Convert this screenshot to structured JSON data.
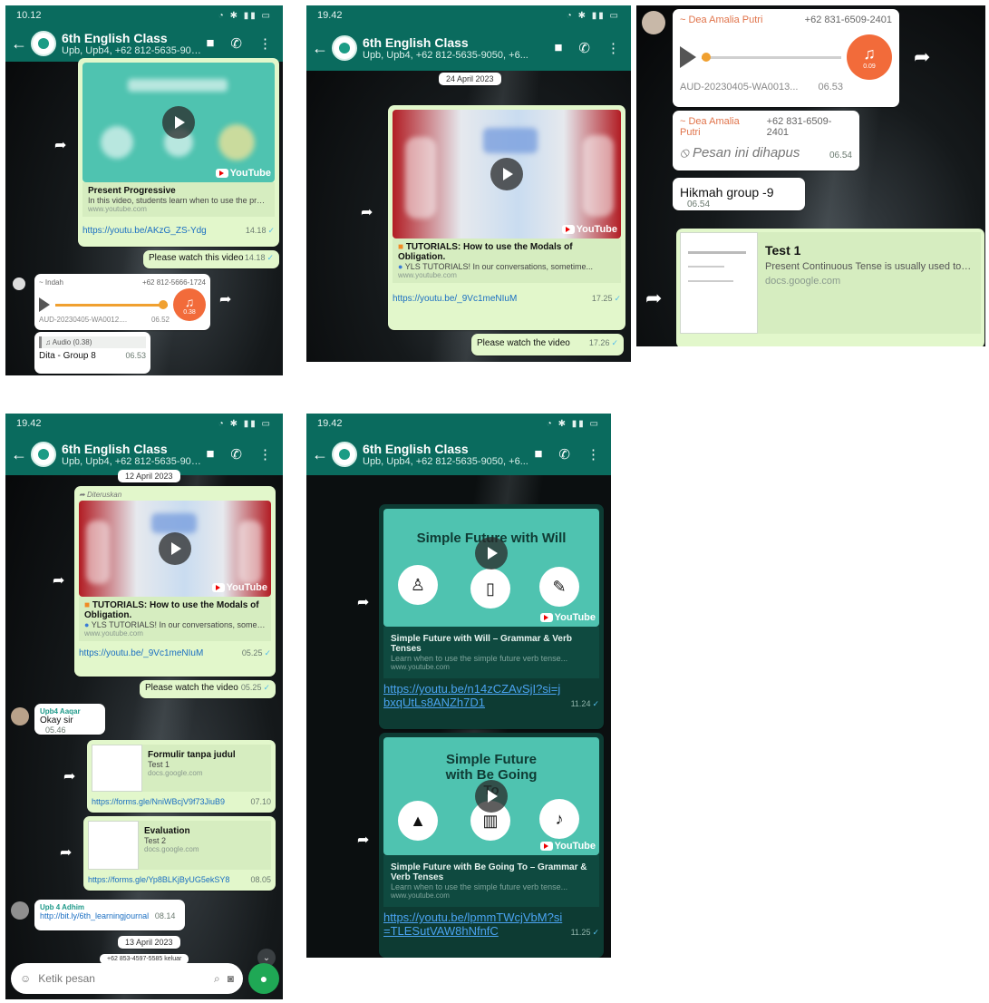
{
  "header": {
    "time_a": "19.42",
    "time_b": "10.12",
    "title": "6th English Class",
    "subtitle": "Upb, Upb4, +62 812-5635-9050, +6..."
  },
  "s1": {
    "card_title": "Present Progressive",
    "card_desc": "In this video, students learn when to use the present pro...",
    "card_domain": "www.youtube.com",
    "url": "https://youtu.be/AKzG_ZS-Ydg",
    "url_time": "14.18",
    "msg2": "Please watch this video",
    "msg2_time": "14.18",
    "sender": "~ Indah",
    "sender_phone": "+62 812-5666-1724",
    "audio_file": "AUD-20230405-WA0012....",
    "audio_time": "06.52",
    "audio_dur": "0.38",
    "reply_quote": "Audio (0.38)",
    "reply_text": "Dita - Group 8",
    "reply_time": "06.53",
    "yt": "YouTube"
  },
  "s2": {
    "date": "24 April 2023",
    "card_title": "TUTORIALS: How to use the Modals of Obligation.",
    "card_desc": "YLS TUTORIALS! In our conversations, sometime...",
    "card_domain": "www.youtube.com",
    "url": "https://youtu.be/_9Vc1meNIuM",
    "url_time": "17.25",
    "msg2": "Please watch the video",
    "msg2_time": "17.26",
    "yt": "YouTube"
  },
  "s3": {
    "sender": "~ Dea Amalia Putri",
    "sender_phone": "+62 831-6509-2401",
    "audio_file": "AUD-20230405-WA0013...",
    "audio_time": "06.53",
    "audio_dur": "0.09",
    "deleted": "Pesan ini dihapus",
    "deleted_time": "06.54",
    "msg": "Hikmah group -9",
    "msg_time": "06.54",
    "doc_title": "Test 1",
    "doc_desc": "Present Continuous Tense is usually used to talk ab...",
    "doc_domain": "docs.google.com"
  },
  "s4": {
    "date": "12 April 2023",
    "forwarded": "Diteruskan",
    "card_title": "TUTORIALS: How to use the Modals of Obligation.",
    "card_desc": "YLS TUTORIALS! In our conversations, sometime...",
    "card_domain": "www.youtube.com",
    "url": "https://youtu.be/_9Vc1meNIuM",
    "url_time": "05.25",
    "msg2": "Please watch the video",
    "msg2_time": "05.25",
    "in1_sender": "Upb4 Aaqar",
    "in1_text": "Okay sir",
    "in1_time": "05.46",
    "form1_title": "Formulir tanpa judul",
    "form1_desc": "Test 1",
    "form1_domain": "docs.google.com",
    "form1_url": "https://forms.gle/NniWBcjV9f73JiuB9",
    "form1_time": "07.10",
    "form2_title": "Evaluation",
    "form2_desc": "Test 2",
    "form2_domain": "docs.google.com",
    "form2_url": "https://forms.gle/Yp8BLKjByUG5ekSY8",
    "form2_time": "08.05",
    "in2_sender": "Upb 4 Adhim",
    "in2_text": "http://bit.ly/6th_learningjournal",
    "in2_time": "08.14",
    "date2": "13 April 2023",
    "system": "+62 853-4597-5585 keluar",
    "composer_placeholder": "Ketik pesan",
    "yt": "YouTube"
  },
  "s5": {
    "v1_banner": "Simple Future with Will",
    "v1_title": "Simple Future with Will – Grammar & Verb Tenses",
    "v1_desc": "Learn when to use the simple future verb tense...",
    "v1_domain": "www.youtube.com",
    "v1_url": "https://youtu.be/n14zCZAvSjI?si=jbxqUtLs8ANZh7D1",
    "v1_time": "11.24",
    "v2_banner": "Simple Future with Be Going To",
    "v2_title": "Simple Future with Be Going To – Grammar & Verb Tenses",
    "v2_desc": "Learn when to use the simple future verb tense...",
    "v2_domain": "www.youtube.com",
    "v2_url": "https://youtu.be/lpmmTWcjVbM?si=TLESutVAW8hNfnfC",
    "v2_time": "11.25",
    "yt": "YouTube"
  }
}
